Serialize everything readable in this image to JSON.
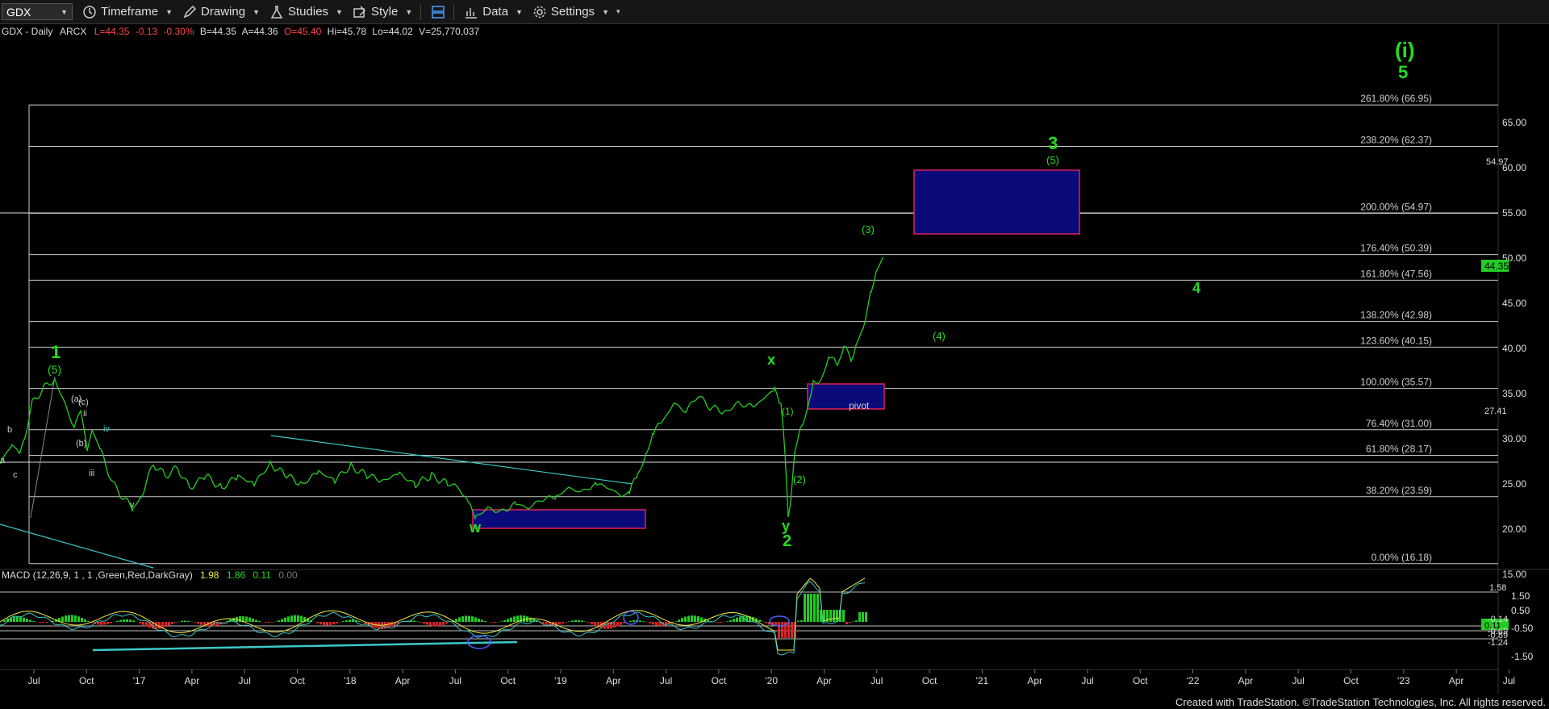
{
  "toolbar": {
    "symbol": "GDX",
    "timeframe": "Timeframe",
    "drawing": "Drawing",
    "studies": "Studies",
    "style": "Style",
    "data": "Data",
    "settings": "Settings"
  },
  "header": {
    "name": "GDX - Daily",
    "exchange": "ARCX",
    "last": "L=44.35",
    "change": "-0.13",
    "pct": "-0.30%",
    "bid": "B=44.35",
    "ask": "A=44.36",
    "open": "O=45.40",
    "high": "Hi=45.78",
    "low": "Lo=44.02",
    "volume": "V=25,770,037"
  },
  "price_axis": [
    "65.00",
    "60.00",
    "55.00",
    "50.00",
    "45.00",
    "40.00",
    "35.00",
    "30.00",
    "25.00",
    "20.00",
    "15.00"
  ],
  "fib_labels": [
    {
      "text": "261.80% (66.95)"
    },
    {
      "text": "238.20% (62.37)"
    },
    {
      "text": "200.00% (54.97)"
    },
    {
      "text": "176.40% (50.39)"
    },
    {
      "text": "161.80% (47.56)"
    },
    {
      "text": "138.20% (42.98)"
    },
    {
      "text": "123.60% (40.15)"
    },
    {
      "text": "100.00% (35.57)"
    },
    {
      "text": "76.40% (31.00)"
    },
    {
      "text": "61.80% (28.17)"
    },
    {
      "text": "38.20% (23.59)"
    },
    {
      "text": "0.00% (16.18)"
    }
  ],
  "price_tags": {
    "last": "44.35",
    "top_tag": "54.97",
    "level": "27.41"
  },
  "wave_labels": {
    "i": "(i)",
    "five_big": "5",
    "three": "3",
    "three_sub": "(5)",
    "sub3": "(3)",
    "four": "4",
    "sub4": "(4)",
    "x": "x",
    "one": "1",
    "one_sub": "(5)",
    "y": "y",
    "two": "2",
    "sub2": "(2)",
    "sub1": "(1)",
    "w": "w",
    "a": "a",
    "b": "b",
    "c": "c",
    "pa": "(a)",
    "pb": "(b)",
    "pc": "(c)",
    "ii": "ii",
    "iii": "iii",
    "iv": "iv",
    "v": "v",
    "pivot": "pivot"
  },
  "macd": {
    "title": "MACD (12,26,9, 1 , 1 ,Green,Red,DarkGray)",
    "v1": "1.98",
    "v2": "1.86",
    "v3": "0.11",
    "v4": "0.00",
    "axis": [
      "1.50",
      "0.50",
      "-0.50",
      "-1.50"
    ],
    "level_tag": "1.58",
    "tags": [
      "0.11",
      "-0.14",
      "-0.69",
      "-0.89",
      "-1.24"
    ]
  },
  "time_axis": [
    "Jul",
    "Oct",
    "'17",
    "Apr",
    "Jul",
    "Oct",
    "'18",
    "Apr",
    "Jul",
    "Oct",
    "'19",
    "Apr",
    "Jul",
    "Oct",
    "'20",
    "Apr",
    "Jul",
    "Oct",
    "'21",
    "Apr",
    "Jul",
    "Oct",
    "'22",
    "Apr",
    "Jul",
    "Oct",
    "'23",
    "Apr",
    "Jul"
  ],
  "footer": "Created with TradeStation. ©TradeStation Technologies, Inc. All rights reserved.",
  "colors": {
    "price_line": "#22cc22",
    "wave_green": "#22dd22",
    "fib_line": "#c8c8c8",
    "box_fill": "#0a0a7a",
    "box_border": "#dd2255",
    "trend_line": "#3cc8c8",
    "macd_up": "#22cc22",
    "macd_down": "#dd2222"
  }
}
